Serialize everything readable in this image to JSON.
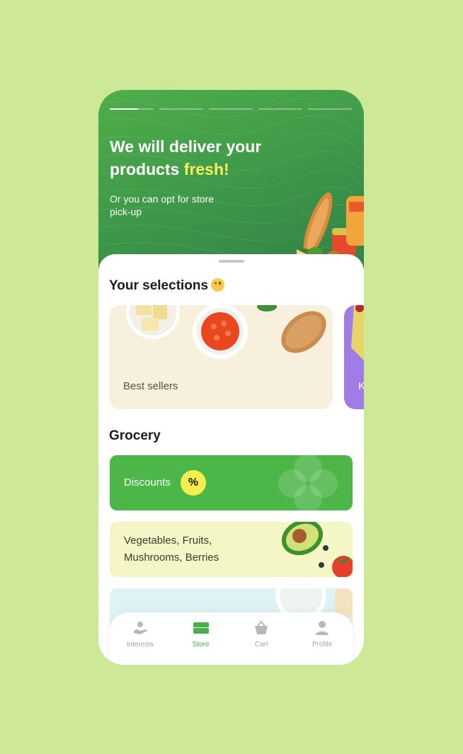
{
  "hero": {
    "title_line1": "We will deliver your",
    "title_line2_pre": "products ",
    "title_line2_accent": "fresh!",
    "subtitle": "Or you can opt for store pick-up",
    "stories": [
      {
        "progress": 0.65
      },
      {
        "progress": 0
      },
      {
        "progress": 0
      },
      {
        "progress": 0
      },
      {
        "progress": 0
      }
    ]
  },
  "selections": {
    "title": "Your selections",
    "emoji": "wink-emoji",
    "cards": [
      {
        "label": "Best sellers"
      },
      {
        "label": "K"
      }
    ]
  },
  "grocery": {
    "title": "Grocery",
    "categories": [
      {
        "label": "Discounts",
        "badge": "%"
      },
      {
        "label_line1": "Vegetables, Fruits,",
        "label_line2": "Mushrooms, Berries"
      }
    ]
  },
  "tabbar": {
    "tabs": [
      {
        "label": "Interests",
        "icon": "interests-icon"
      },
      {
        "label": "Store",
        "icon": "store-icon",
        "active": true
      },
      {
        "label": "Cart",
        "icon": "cart-icon"
      },
      {
        "label": "Profile",
        "icon": "profile-icon"
      }
    ]
  },
  "colors": {
    "background": "#cde896",
    "brand_green": "#4cb648",
    "accent_yellow": "#f6f15a",
    "purple_card": "#a07de6"
  }
}
